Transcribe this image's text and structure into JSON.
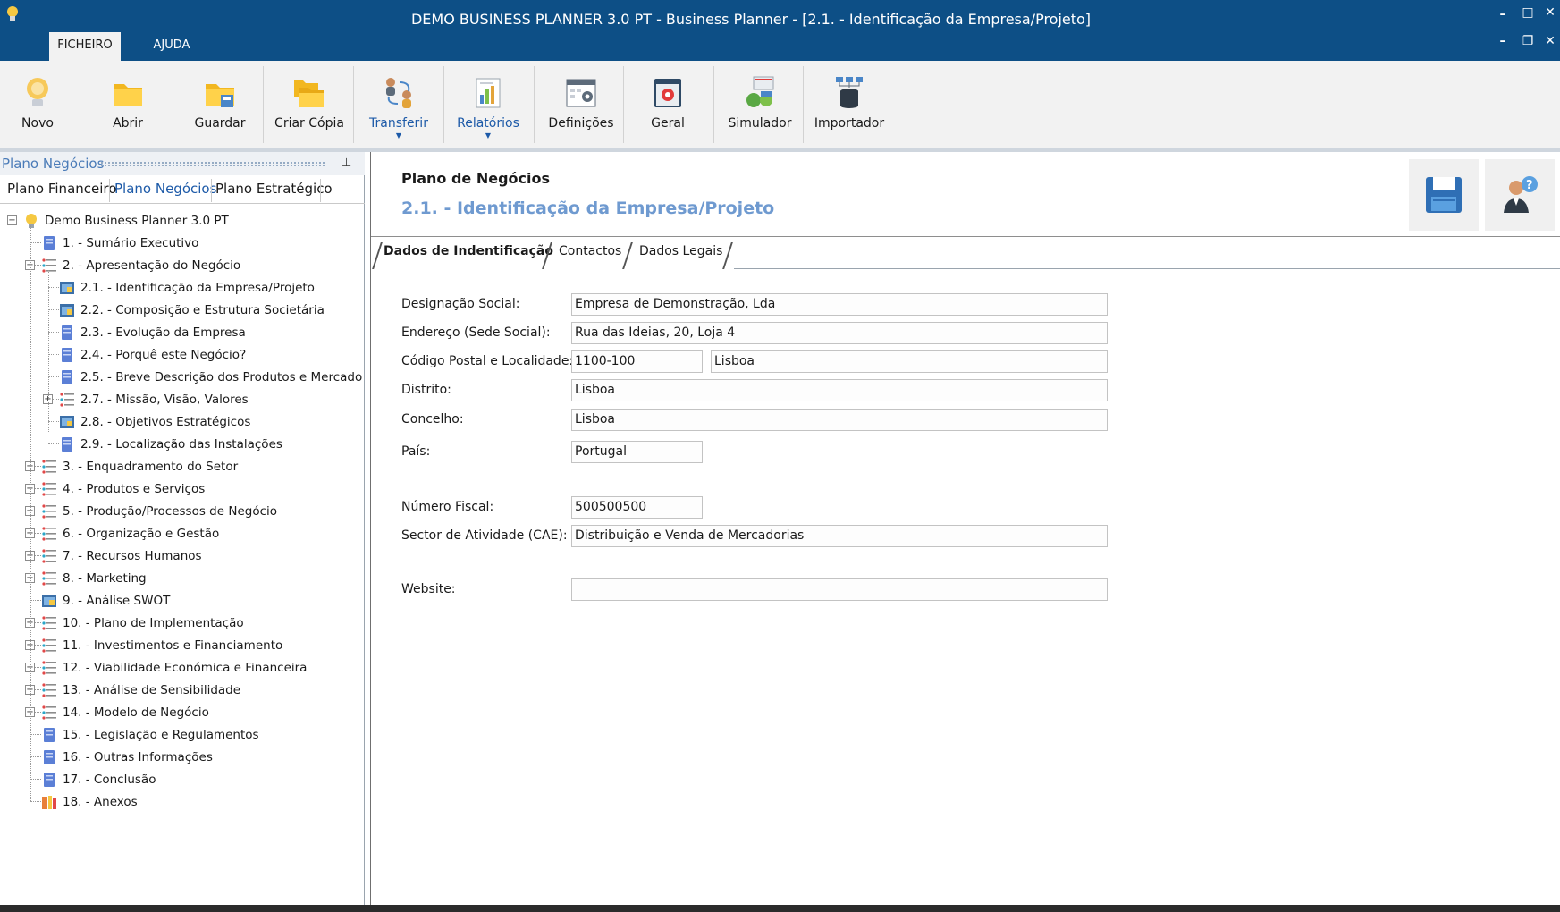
{
  "window": {
    "title": "DEMO BUSINESS PLANNER 3.0 PT - Business Planner - [2.1. - Identificação da Empresa/Projeto]",
    "menu": [
      {
        "label": "FICHEIRO",
        "active": true
      },
      {
        "label": "AJUDA",
        "active": false
      }
    ]
  },
  "ribbon": {
    "buttons": [
      {
        "label": "Novo",
        "icon": "lightbulb-icon"
      },
      {
        "label": "Abrir",
        "icon": "folder-icon"
      },
      {
        "label": "Guardar",
        "icon": "folder-save-icon"
      },
      {
        "label": "Criar Cópia",
        "icon": "folder-copy-icon"
      },
      {
        "label": "Transferir",
        "icon": "transfer-users-icon",
        "dropdown": true
      },
      {
        "label": "Relatórios",
        "icon": "report-chart-icon",
        "dropdown": true
      },
      {
        "label": "Definições",
        "icon": "settings-calendar-icon"
      },
      {
        "label": "Geral",
        "icon": "gear-window-icon"
      },
      {
        "label": "Simulador",
        "icon": "simulator-money-icon"
      },
      {
        "label": "Importador",
        "icon": "database-import-icon"
      }
    ]
  },
  "left_panel": {
    "title": "Plano Negócios",
    "tabs": [
      {
        "label": "Plano Financeiro",
        "active": false
      },
      {
        "label": "Plano Negócios",
        "active": true
      },
      {
        "label": "Plano Estratégico",
        "active": false
      }
    ],
    "tree": {
      "root": "Demo Business Planner 3.0 PT",
      "items": [
        {
          "label": "1. - Sumário Executivo",
          "icon": "document-icon",
          "level": 1,
          "expander": ""
        },
        {
          "label": "2. - Apresentação do Negócio",
          "icon": "list-icon",
          "level": 1,
          "expander": "−"
        },
        {
          "label": "2.1. - Identificação da Empresa/Projeto",
          "icon": "form-icon",
          "level": 2,
          "expander": ""
        },
        {
          "label": "2.2. - Composição e Estrutura Societária",
          "icon": "form-icon",
          "level": 2,
          "expander": ""
        },
        {
          "label": "2.3. - Evolução da Empresa",
          "icon": "document-icon",
          "level": 2,
          "expander": ""
        },
        {
          "label": "2.4. - Porquê este Negócio?",
          "icon": "document-icon",
          "level": 2,
          "expander": ""
        },
        {
          "label": "2.5. - Breve Descrição dos Produtos e Mercado",
          "icon": "document-icon",
          "level": 2,
          "expander": ""
        },
        {
          "label": "2.7. - Missão, Visão, Valores",
          "icon": "list-icon",
          "level": 2,
          "expander": "+"
        },
        {
          "label": "2.8. - Objetivos Estratégicos",
          "icon": "form-icon",
          "level": 2,
          "expander": ""
        },
        {
          "label": "2.9. - Localização das Instalações",
          "icon": "document-icon",
          "level": 2,
          "expander": ""
        },
        {
          "label": "3. - Enquadramento do Setor",
          "icon": "list-icon",
          "level": 1,
          "expander": "+"
        },
        {
          "label": "4. - Produtos e Serviços",
          "icon": "list-icon",
          "level": 1,
          "expander": "+"
        },
        {
          "label": "5. - Produção/Processos de Negócio",
          "icon": "list-icon",
          "level": 1,
          "expander": "+"
        },
        {
          "label": "6. - Organização e Gestão",
          "icon": "list-icon",
          "level": 1,
          "expander": "+"
        },
        {
          "label": "7. - Recursos Humanos",
          "icon": "list-icon",
          "level": 1,
          "expander": "+"
        },
        {
          "label": "8. - Marketing",
          "icon": "list-icon",
          "level": 1,
          "expander": "+"
        },
        {
          "label": "9. - Análise SWOT",
          "icon": "form-icon",
          "level": 1,
          "expander": ""
        },
        {
          "label": "10. - Plano de Implementação",
          "icon": "list-icon",
          "level": 1,
          "expander": "+"
        },
        {
          "label": "11. - Investimentos e Financiamento",
          "icon": "list-icon",
          "level": 1,
          "expander": "+"
        },
        {
          "label": "12. - Viabilidade Económica e Financeira",
          "icon": "list-icon",
          "level": 1,
          "expander": "+"
        },
        {
          "label": "13. - Análise de Sensibilidade",
          "icon": "list-icon",
          "level": 1,
          "expander": "+"
        },
        {
          "label": "14. - Modelo de Negócio",
          "icon": "list-icon",
          "level": 1,
          "expander": "+"
        },
        {
          "label": "15. - Legislação e Regulamentos",
          "icon": "document-icon",
          "level": 1,
          "expander": ""
        },
        {
          "label": "16. - Outras Informações",
          "icon": "document-icon",
          "level": 1,
          "expander": ""
        },
        {
          "label": "17. - Conclusão",
          "icon": "document-icon",
          "level": 1,
          "expander": ""
        },
        {
          "label": "18. - Anexos",
          "icon": "attachment-icon",
          "level": 1,
          "expander": ""
        }
      ]
    }
  },
  "content": {
    "header_title": "Plano de Negócios",
    "header_subtitle": "2.1. - Identificação da Empresa/Projeto",
    "tabs": [
      {
        "label": "Dados de Indentificação",
        "active": true
      },
      {
        "label": "Contactos",
        "active": false
      },
      {
        "label": "Dados Legais",
        "active": false
      }
    ],
    "form": {
      "designacao_label": "Designação Social:",
      "designacao_value": "Empresa de Demonstração, Lda",
      "endereco_label": "Endereço (Sede Social):",
      "endereco_value": "Rua das Ideias, 20, Loja 4",
      "codpostal_label": "Código Postal e Localidade:",
      "codpostal_value": "1100-100",
      "localidade_value": "Lisboa",
      "distrito_label": "Distrito:",
      "distrito_value": "Lisboa",
      "concelho_label": "Concelho:",
      "concelho_value": "Lisboa",
      "pais_label": "País:",
      "pais_value": "Portugal",
      "nif_label": "Número Fiscal:",
      "nif_value": "500500500",
      "cae_label": "Sector de Atividade (CAE):",
      "cae_value": "Distribuição e Venda de Mercadorias",
      "website_label": "Website:",
      "website_value": ""
    }
  },
  "colors": {
    "titlebar": "#0d4f86",
    "accent_blue": "#1d5aa8",
    "subtitle_blue": "#6f9ad0"
  }
}
